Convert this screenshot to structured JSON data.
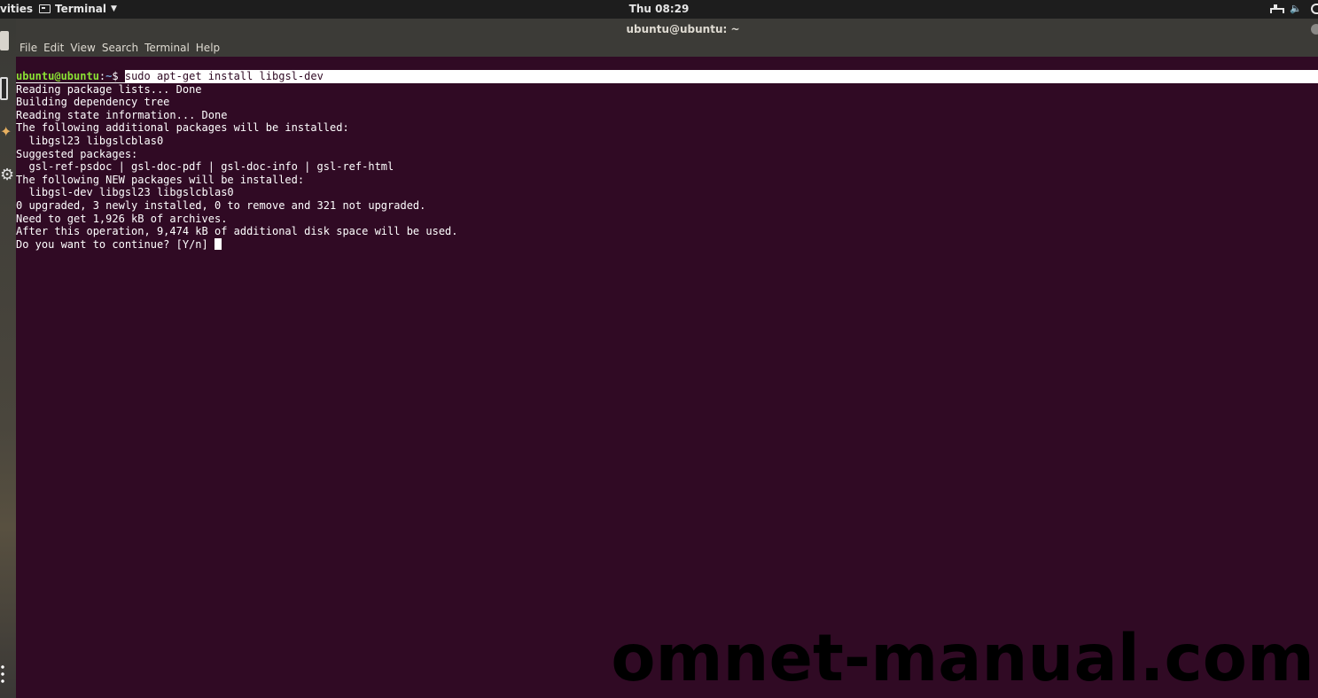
{
  "topbar": {
    "activities": "vities",
    "app_name": "Terminal",
    "clock": "Thu 08:29",
    "tray_volume": "🔈"
  },
  "window": {
    "title": "ubuntu@ubuntu: ~"
  },
  "menu": {
    "items": [
      "File",
      "Edit",
      "View",
      "Search",
      "Terminal",
      "Help"
    ]
  },
  "terminal": {
    "prompt_user": "ubuntu@ubuntu",
    "prompt_sep": ":",
    "prompt_path": "~",
    "prompt_symbol": "$ ",
    "command": "sudo apt-get install libgsl-dev",
    "output": [
      "Reading package lists... Done",
      "Building dependency tree",
      "Reading state information... Done",
      "The following additional packages will be installed:",
      "  libgsl23 libgslcblas0",
      "Suggested packages:",
      "  gsl-ref-psdoc | gsl-doc-pdf | gsl-doc-info | gsl-ref-html",
      "The following NEW packages will be installed:",
      "  libgsl-dev libgsl23 libgslcblas0",
      "0 upgraded, 3 newly installed, 0 to remove and 321 not upgraded.",
      "Need to get 1,926 kB of archives.",
      "After this operation, 9,474 kB of additional disk space will be used."
    ],
    "last_line": "Do you want to continue? [Y/n] "
  },
  "watermark": "omnet-manual.com",
  "colors": {
    "terminal_bg": "#300a24",
    "prompt_user": "#8ae234",
    "prompt_path": "#729fcf",
    "chrome_bg": "#3c3b37"
  }
}
